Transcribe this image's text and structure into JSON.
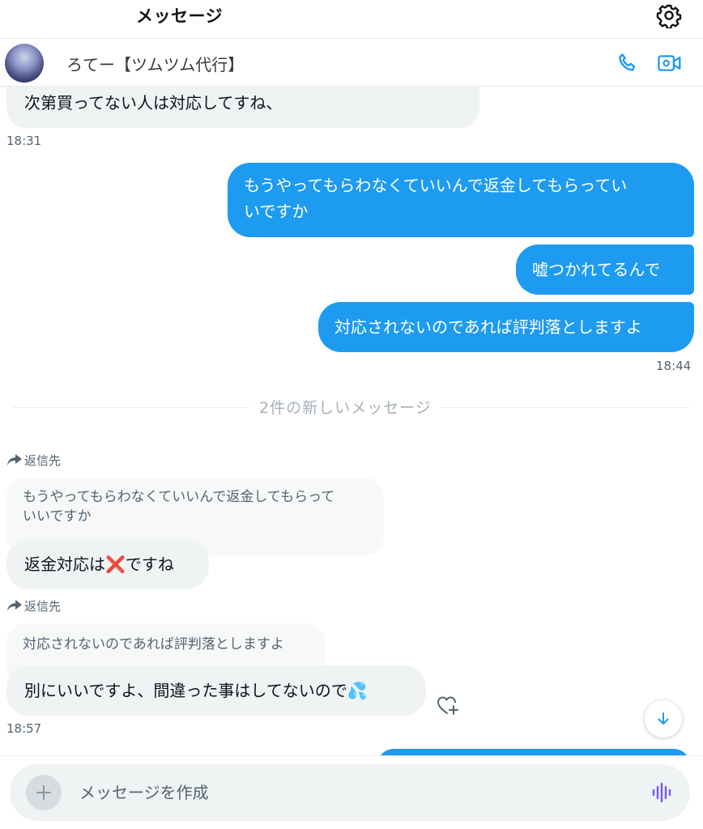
{
  "header": {
    "title": "メッセージ",
    "settings_icon": "gear-icon"
  },
  "conversation": {
    "name": "ろてー【ツムツム代行】",
    "call_icon": "phone-icon",
    "video_icon": "video-camera-icon"
  },
  "messages": {
    "m1": {
      "text": "次第買ってない人は対応してすね、",
      "time": "18:31"
    },
    "m2": {
      "line1": "もうやってもらわなくていいんで返金してもらってい",
      "line2": "いですか"
    },
    "m3": {
      "text": "嘘つかれてるんで"
    },
    "m4": {
      "text": "対応されないのであれば評判落としますよ",
      "time": "18:44"
    },
    "new_divider": "2件の新しいメッセージ",
    "r1": {
      "reply_label": "返信先",
      "quote_line1": "もうやってもらわなくていいんで返金してもらって",
      "quote_line2": "いいですか",
      "text_before": "返金対応は",
      "emoji": "❌",
      "text_after": "ですね"
    },
    "r2": {
      "reply_label": "返信先",
      "quote": "対応されないのであれば評判落としますよ",
      "text": "別にいいですよ、間違った事はしてないので",
      "emoji": "💦",
      "time": "18:57"
    }
  },
  "composer": {
    "placeholder": "メッセージを作成",
    "add_icon": "plus-icon",
    "voice_icon": "voice-waveform-icon"
  },
  "colors": {
    "accent": "#1d9bf0",
    "incoming_bubble": "#eff3f4",
    "voice": "#7856ff"
  }
}
